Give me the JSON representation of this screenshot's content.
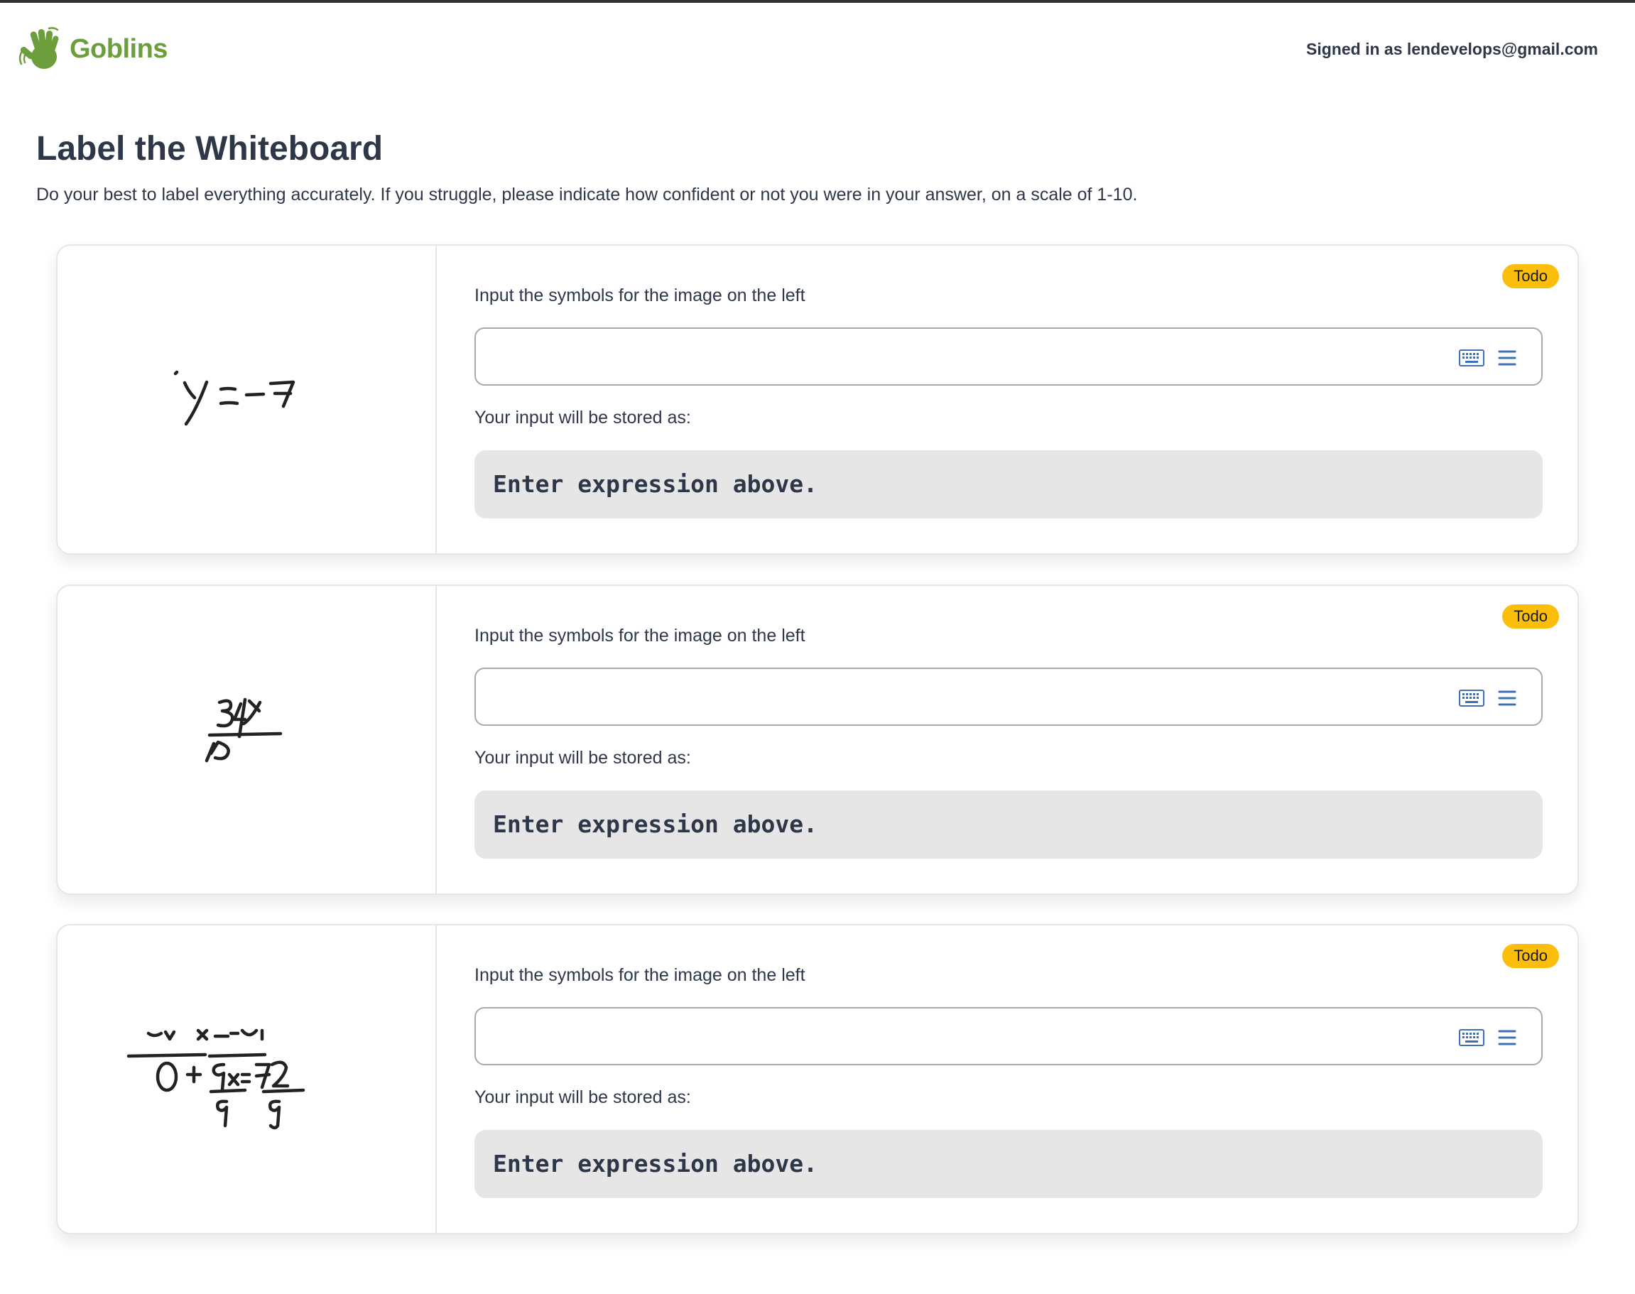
{
  "app": {
    "logo_text": "Goblins",
    "signed_in": "Signed in as lendevelops@gmail.com",
    "brand_color": "#6c9f3c"
  },
  "page": {
    "title": "Label the Whiteboard",
    "subtitle": "Do your best to label everything accurately. If you struggle, please indicate how confident or not you were in your answer, on a scale of 1-10."
  },
  "cards": [
    {
      "status": "Todo",
      "prompt": "Input the symbols for the image on the left",
      "input_value": "",
      "stored_label": "Your input will be stored as:",
      "stored_value": "Enter expression above."
    },
    {
      "status": "Todo",
      "prompt": "Input the symbols for the image on the left",
      "input_value": "",
      "stored_label": "Your input will be stored as:",
      "stored_value": "Enter expression above."
    },
    {
      "status": "Todo",
      "prompt": "Input the symbols for the image on the left",
      "input_value": "",
      "stored_label": "Your input will be stored as:",
      "stored_value": "Enter expression above."
    }
  ],
  "icons": {
    "logo": "waving-hand-icon",
    "keyboard": "keyboard-icon",
    "menu": "menu-icon"
  },
  "colors": {
    "badge": "#fbbf0b",
    "stored_box": "#e6e6e6"
  }
}
